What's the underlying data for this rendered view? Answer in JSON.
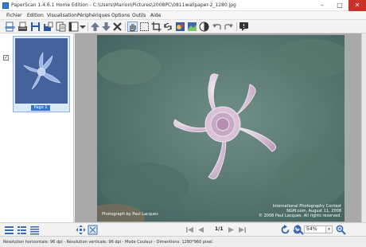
{
  "window": {
    "title": "PaperScan 1.4.6.1 Home Edition - C:\\Users\\Marion\\Pictures\\2008PC\\0811wallpaper-2_1280.jpg",
    "minimize": "–",
    "maximize": "□",
    "close": "✕"
  },
  "menu": [
    "Fichier",
    "Edition",
    "Visualisation",
    "Périphériques",
    "Options",
    "Outils",
    "Aide"
  ],
  "toolbar": {
    "icons": [
      "scan-icon",
      "import-icon",
      "save-icon",
      "save-as-icon",
      "print-icon",
      "page-layout-icon",
      "arrow-up-icon",
      "arrow-down-icon",
      "delete-icon",
      "pan-hand-icon",
      "select-area-icon",
      "crop-icon",
      "rotate-icon",
      "color-adjust-icon",
      "image-effects-icon",
      "contrast-icon",
      "undo-icon",
      "redo-icon",
      "comment-icon"
    ]
  },
  "thumbnails": [
    {
      "label": "Page 1",
      "checked": "✓"
    }
  ],
  "image": {
    "credit": "Photograph by Paul Lacques",
    "caption_lines": [
      "International Photography Contest",
      "NGM.com, August 11, 2008",
      "© 2008 Paul Lacques. All rights reserved."
    ]
  },
  "navigation": {
    "page_counter": "1/1"
  },
  "zoom": {
    "value": "54%"
  },
  "status": {
    "text": "Résolution horizontale: 96 dpi - Résolution verticale: 96 dpi - Mode Couleur - Dimentions: 1280*960 pixel."
  },
  "colors": {
    "accent": "#3a78c8",
    "close_button": "#c8302a",
    "viewer_background": "#a9a9a9"
  }
}
